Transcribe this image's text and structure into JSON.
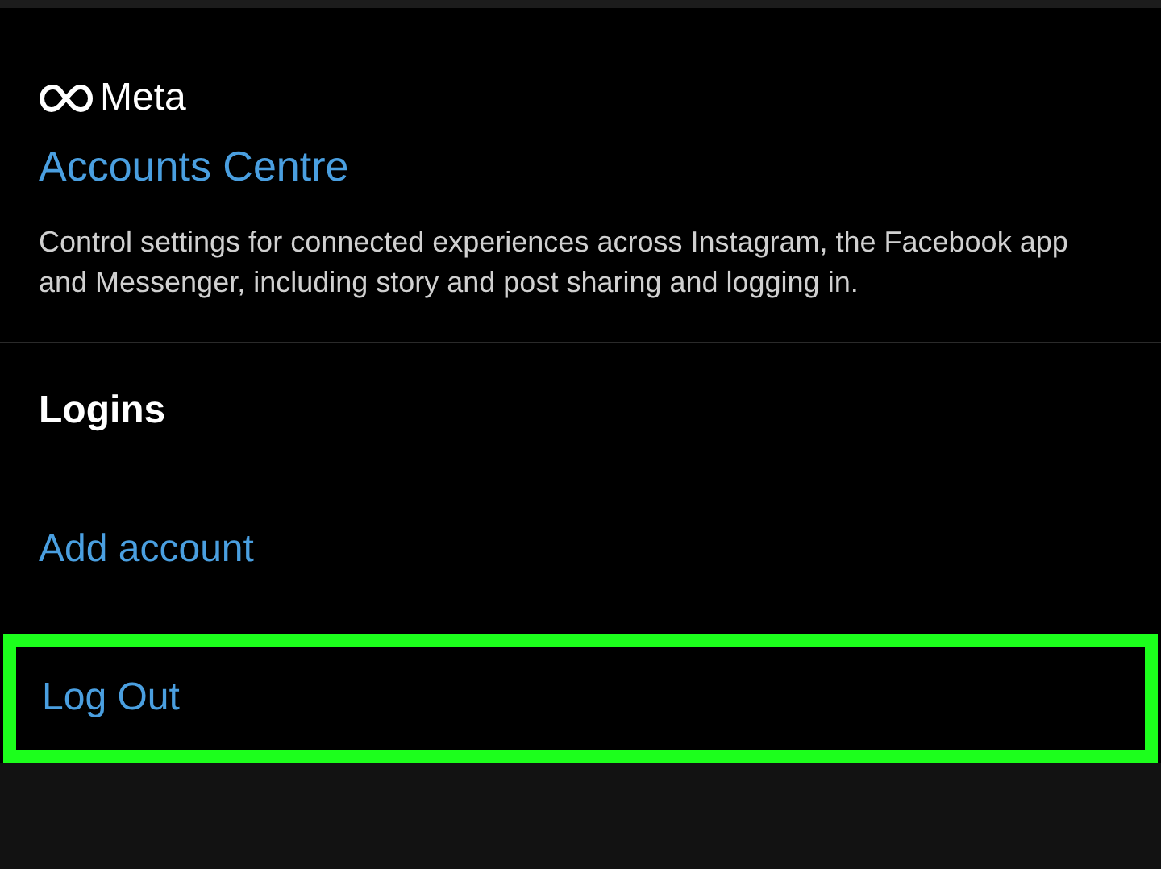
{
  "brand": {
    "name": "Meta"
  },
  "accounts_centre": {
    "title": "Accounts Centre",
    "description": "Control settings for connected experiences across Instagram, the Facebook app and Messenger, including story and post sharing and logging in."
  },
  "logins": {
    "heading": "Logins",
    "items": [
      {
        "label": "Add account",
        "highlighted": false
      },
      {
        "label": "Log Out",
        "highlighted": true
      }
    ]
  }
}
